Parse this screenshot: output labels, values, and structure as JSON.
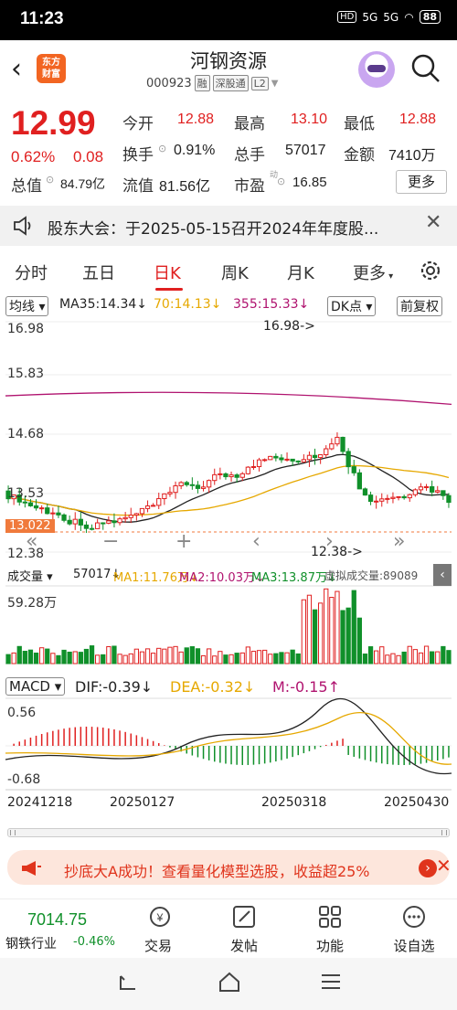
{
  "statusbar": {
    "time": "11:23",
    "network1": "HD",
    "sig1": "5G",
    "sig2": "5G",
    "battery": "88"
  },
  "header": {
    "logo_line1": "东方",
    "logo_line2": "财富",
    "name": "河钢资源",
    "code": "000923",
    "tags": [
      "融",
      "深股通",
      "L2"
    ]
  },
  "quote": {
    "price": "12.99",
    "pct": "0.62%",
    "change": "0.08",
    "open_label": "今开",
    "open": "12.88",
    "high_label": "最高",
    "high": "13.10",
    "low_label": "最低",
    "low": "12.88",
    "turnover_label": "换手",
    "turnover": "0.91%",
    "volume_label": "总手",
    "volume": "57017",
    "amount_label": "金额",
    "amount": "7410万",
    "mcap_label": "总值",
    "mcap": "84.79亿",
    "float_label": "流值",
    "float": "81.56亿",
    "pe_label": "市盈",
    "pe_sup": "动",
    "pe": "16.85",
    "more": "更多"
  },
  "notice": {
    "text": "股东大会：于2025-05-15召开2024年年度股..."
  },
  "tabs": [
    "分时",
    "五日",
    "日K",
    "周K",
    "月K",
    "更多"
  ],
  "active_tab": "日K",
  "indicator": {
    "ma_label": "均线",
    "ma35": "MA35:14.34",
    "ma70": "70:14.13",
    "ma355": "355:15.33",
    "dk": "DK点",
    "adjust": "前复权"
  },
  "kline": {
    "y_labels": [
      "16.98",
      "15.83",
      "14.68",
      "13.53",
      "12.38"
    ],
    "current_price_tag": "13.022",
    "high_marker": "16.98->",
    "low_marker": "12.38->",
    "controls": [
      "«",
      "−",
      "+",
      "‹",
      "›",
      "»"
    ]
  },
  "volume": {
    "label": "成交量",
    "value": "57017",
    "ma1": "MA1:11.76万",
    "ma2": "MA2:10.03万",
    "ma3": "MA3:13.87万",
    "virtual": "虚拟成交量:89089",
    "ymax": "59.28万"
  },
  "macd": {
    "label": "MACD",
    "dif": "DIF:-0.39",
    "dea": "DEA:-0.32",
    "m": "M:-0.15",
    "ymax": "0.56",
    "ymin": "-0.68",
    "dates": [
      "20241218",
      "20250127",
      "20250318",
      "20250430"
    ]
  },
  "ad": {
    "text": "抄底大A成功！查看量化模型选股，收益超25%"
  },
  "bottom": {
    "index_value": "7014.75",
    "index_name": "钢铁行业",
    "index_pct": "-0.46%",
    "items": [
      "交易",
      "发帖",
      "功能",
      "设自选"
    ]
  },
  "colors": {
    "up": "#e02020",
    "down": "#10902a",
    "accent": "#f26522"
  }
}
